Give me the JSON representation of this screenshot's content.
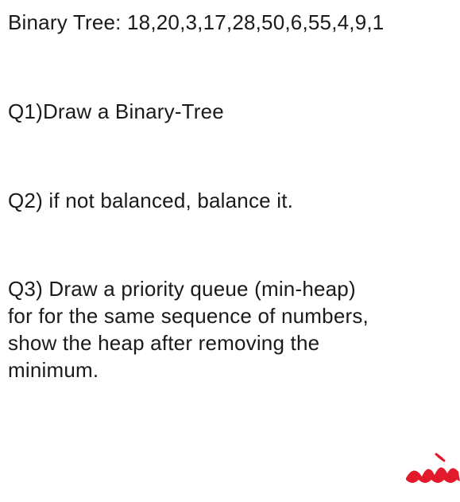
{
  "header": {
    "label_prefix": "Binary Tree: ",
    "sequence": "18,20,3,17,28,50,6,55,4,9,1"
  },
  "questions": {
    "q1": "Q1)Draw a Binary-Tree",
    "q2": "Q2) if not balanced, balance it.",
    "q3_line1": "Q3) Draw a priority queue (min-heap)",
    "q3_line2": "for for the same sequence of numbers,",
    "q3_line3": "show the heap after removing the",
    "q3_line4": "minimum."
  },
  "annotation": {
    "color": "#e21b2c"
  }
}
